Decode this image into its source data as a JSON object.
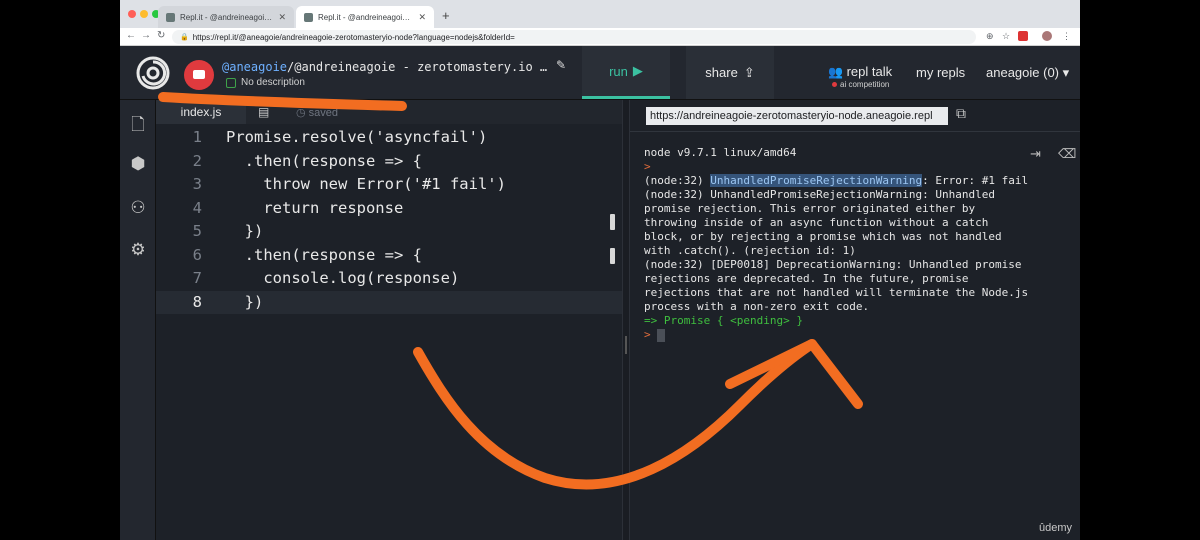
{
  "browser": {
    "tabs": [
      {
        "label": "Repl.it - @andreineagoie - zer",
        "active": false
      },
      {
        "label": "Repl.it - @andreineagoie - zer",
        "active": true
      }
    ],
    "address": "https://repl.it/@aneagoie/andreineagoie-zerotomasteryio-node?language=nodejs&folderId=",
    "address_shown": "https://repl.it/@aneagoie/andreineagoie-zerotomasteryio-node?language=nodejs&folderId="
  },
  "header": {
    "owner": "@aneagoie",
    "title_rest": "/@andreineagoie - zerotomastery.io …",
    "description": "No description",
    "run_label": "run",
    "share_label": "share",
    "repl_talk": "repl talk",
    "ai_competition": "ai competition",
    "my_repls": "my repls",
    "user": "aneagoie (0)"
  },
  "editor": {
    "active_file": "index.js",
    "status": "saved",
    "current_line": 8,
    "lines": [
      {
        "n": 1,
        "code": "Promise.resolve('asyncfail')"
      },
      {
        "n": 2,
        "code": "  .then(response => {"
      },
      {
        "n": 3,
        "code": "    throw new Error('#1 fail')"
      },
      {
        "n": 4,
        "code": "    return response"
      },
      {
        "n": 5,
        "code": "  })"
      },
      {
        "n": 6,
        "code": "  .then(response => {"
      },
      {
        "n": 7,
        "code": "    console.log(response)"
      },
      {
        "n": 8,
        "code": "  })"
      }
    ]
  },
  "console": {
    "url": "https://andreineagoie-zerotomasteryio-node.aneagoie.repl",
    "version_line": "node v9.7.1 linux/amd64",
    "prompt": ">",
    "warning_pre": "(node:32) ",
    "warning_highlight": "UnhandledPromiseRejectionWarning",
    "warning_post": ": Error: #1 fail",
    "output_lines": [
      "(node:32) UnhandledPromiseRejectionWarning: Unhandled",
      "promise rejection. This error originated either by",
      "throwing inside of an async function without a catch",
      "block, or by rejecting a promise which was not handled",
      "with .catch(). (rejection id: 1)",
      "(node:32) [DEP0018] DeprecationWarning: Unhandled promise",
      "rejections are deprecated. In the future, promise",
      "rejections that are not handled will terminate the Node.js",
      "process with a non-zero exit code."
    ],
    "result_line": "=> Promise { <pending> }",
    "input_prompt": ">"
  },
  "watermark": "ûdemy",
  "colors": {
    "annotation": "#f26d21",
    "accent": "#3bc1a1",
    "background": "#1d2128"
  }
}
